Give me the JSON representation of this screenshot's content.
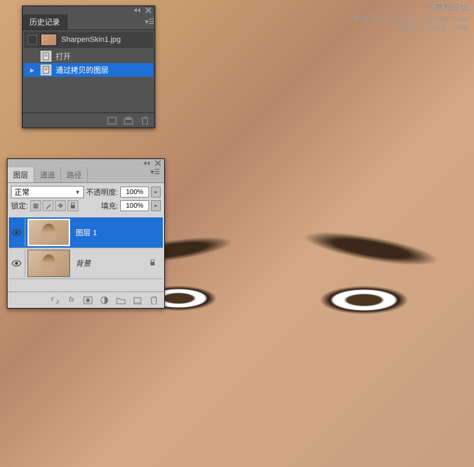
{
  "watermark": {
    "line1": "PS教程论坛",
    "line2": "思缘设计论坛  www.16xx8.com",
    "line3": "BBS.16XX8.COM"
  },
  "history": {
    "title": "历史记录",
    "filename": "SharpenSkin1.jpg",
    "items": [
      {
        "label": "打开",
        "selected": false
      },
      {
        "label": "通过拷贝的图层",
        "selected": true
      }
    ]
  },
  "layers": {
    "tabs": {
      "layers": "图层",
      "channels": "通道",
      "paths": "路径"
    },
    "blend_mode": "正常",
    "opacity_label": "不透明度:",
    "opacity_value": "100%",
    "lock_label": "锁定:",
    "fill_label": "填充:",
    "fill_value": "100%",
    "items": [
      {
        "name": "图层 1",
        "selected": true,
        "visible": true,
        "locked": false
      },
      {
        "name": "背景",
        "selected": false,
        "visible": true,
        "locked": true
      }
    ]
  }
}
